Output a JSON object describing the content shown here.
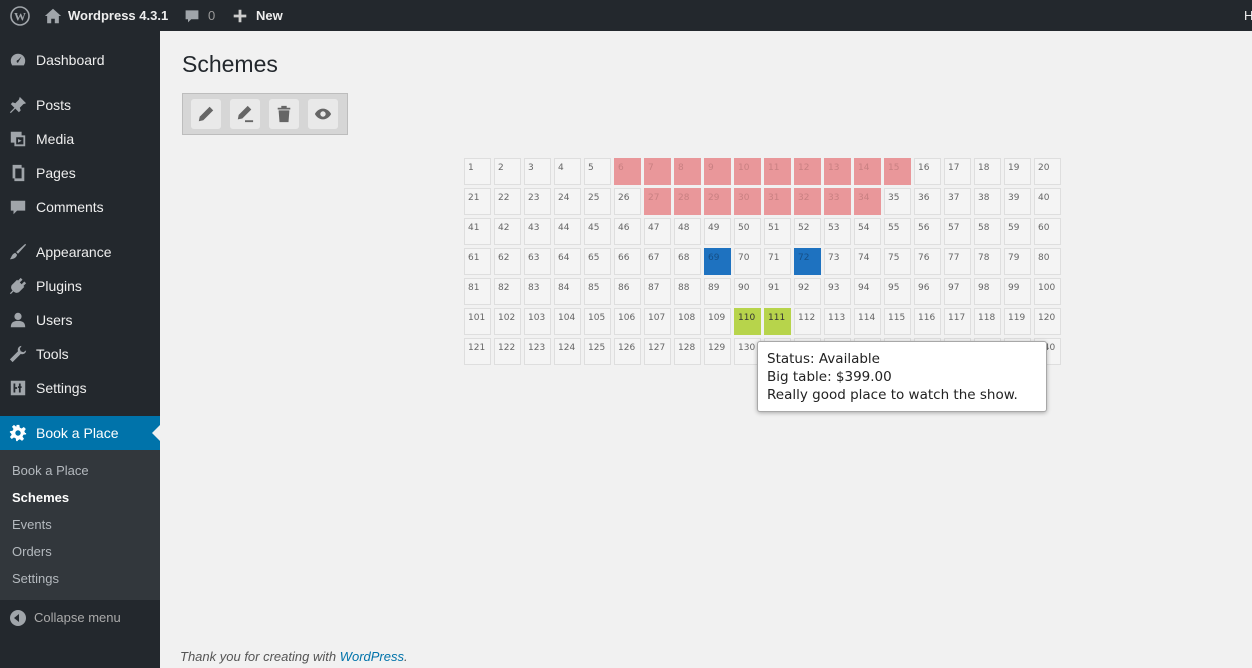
{
  "adminbar": {
    "site_name": "Wordpress 4.3.1",
    "comments_count": "0",
    "new_label": "New",
    "right_text": "H"
  },
  "menu": {
    "items": [
      {
        "label": "Dashboard",
        "icon": "dashboard-icon"
      },
      {
        "label": "Posts",
        "icon": "pin-icon"
      },
      {
        "label": "Media",
        "icon": "media-icon"
      },
      {
        "label": "Pages",
        "icon": "pages-icon"
      },
      {
        "label": "Comments",
        "icon": "comment-icon"
      },
      {
        "label": "Appearance",
        "icon": "brush-icon"
      },
      {
        "label": "Plugins",
        "icon": "plugin-icon"
      },
      {
        "label": "Users",
        "icon": "user-icon"
      },
      {
        "label": "Tools",
        "icon": "wrench-icon"
      },
      {
        "label": "Settings",
        "icon": "sliders-icon"
      },
      {
        "label": "Book a Place",
        "icon": "gear-icon"
      }
    ],
    "submenu": [
      {
        "label": "Book a Place"
      },
      {
        "label": "Schemes"
      },
      {
        "label": "Events"
      },
      {
        "label": "Orders"
      },
      {
        "label": "Settings"
      }
    ],
    "collapse_label": "Collapse menu"
  },
  "page": {
    "title": "Schemes"
  },
  "toolbar": {
    "buttons": [
      "pencil-icon",
      "pencil-line-icon",
      "trash-icon",
      "eye-icon"
    ]
  },
  "scheme": {
    "columns": 20,
    "rows": 7,
    "booked": [
      6,
      7,
      8,
      9,
      10,
      11,
      12,
      13,
      14,
      15,
      27,
      28,
      29,
      30,
      31,
      32,
      33,
      34
    ],
    "selected": [
      69,
      72
    ],
    "available": [
      110,
      111
    ],
    "colors": {
      "booked": "#e9979a",
      "selected": "#1e72c0",
      "available": "#b7d44b",
      "empty": "#f4f4f4"
    }
  },
  "tooltip": {
    "status": "Status: Available",
    "place": "Big table: $399.00",
    "description": "Really good place to watch the show."
  },
  "footer": {
    "text": "Thank you for creating with ",
    "link": "WordPress",
    "suffix": "."
  }
}
